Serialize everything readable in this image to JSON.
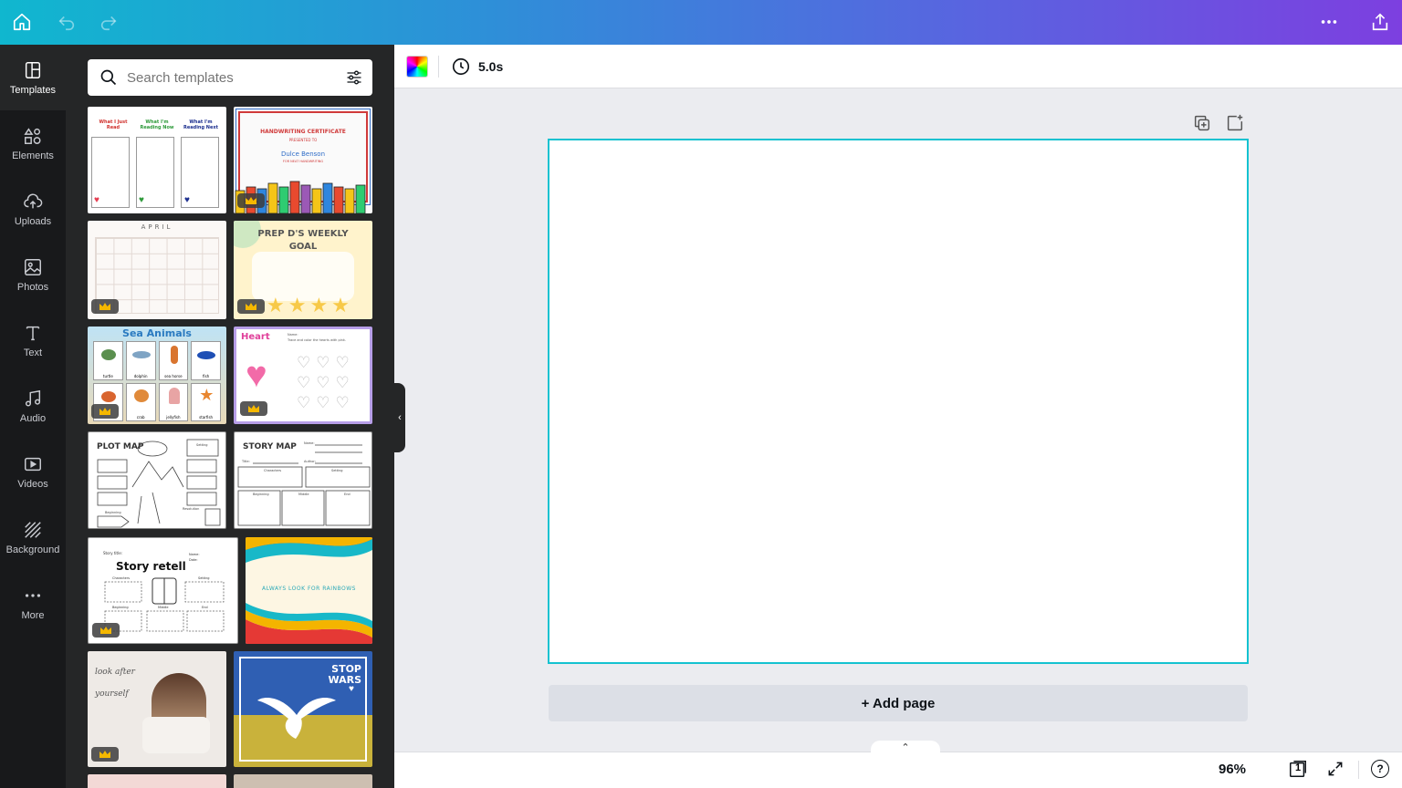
{
  "topbar": {
    "home": "home-icon",
    "undo": "undo-icon",
    "redo": "redo-icon",
    "more": "more-icon",
    "share": "share-icon"
  },
  "rail": {
    "items": [
      {
        "label": "Templates",
        "icon": "templates-icon"
      },
      {
        "label": "Elements",
        "icon": "elements-icon"
      },
      {
        "label": "Uploads",
        "icon": "uploads-icon"
      },
      {
        "label": "Photos",
        "icon": "photos-icon"
      },
      {
        "label": "Text",
        "icon": "text-icon"
      },
      {
        "label": "Audio",
        "icon": "audio-icon"
      },
      {
        "label": "Videos",
        "icon": "videos-icon"
      },
      {
        "label": "Background",
        "icon": "background-icon"
      },
      {
        "label": "More",
        "icon": "more-icon"
      }
    ]
  },
  "panel": {
    "search_placeholder": "Search templates"
  },
  "templates": {
    "t1": {
      "h1": "What I Just Read",
      "h2": "What I'm Reading Now",
      "h3": "What I'm Reading Next"
    },
    "t2": {
      "title": "HANDWRITING CERTIFICATE",
      "sub": "PRESENTED TO",
      "name": "Dulce Benson",
      "line": "FOR NEAT HANDWRITING"
    },
    "t3": {
      "title": "APRIL"
    },
    "t4": {
      "title": "PREP D'S WEEKLY GOAL"
    },
    "t5": {
      "title": "Sea Animals",
      "labels": [
        "turtle",
        "dolphin",
        "sea horse",
        "fish",
        "crab",
        "jellyfish",
        "starfish"
      ]
    },
    "t6": {
      "title": "Heart",
      "line1": "Name:",
      "line2": "Trace and color the hearts with pink."
    },
    "t7": {
      "title": "PLOT MAP",
      "l1": "Setting",
      "l2": "Beginning",
      "l3": "Resolution"
    },
    "t8": {
      "title": "STORY MAP",
      "l1": "Name:",
      "l2": "Title:",
      "l3": "Author:",
      "l4": "Characters",
      "l5": "Setting",
      "l6": "Beginning",
      "l7": "Middle",
      "l8": "End"
    },
    "t9": {
      "title": "Story retell",
      "l0": "Story title:",
      "l1": "Characters",
      "l2": "Setting",
      "l3": "Beginning",
      "l4": "Middle",
      "l5": "End",
      "n1": "Name:",
      "n2": "Date:"
    },
    "t10": {
      "title": "ALWAYS LOOK FOR RAINBOWS"
    },
    "t11": {
      "l1": "look after",
      "l2": "yourself"
    },
    "t12": {
      "title": "STOP WARS"
    }
  },
  "editor": {
    "duration": "5.0s",
    "add_page": "+ Add page",
    "zoom": "96%",
    "page_count": "1",
    "help": "?"
  },
  "colors": {
    "accent": "#14c2d0",
    "rail": "#18191b",
    "panel": "#252627"
  }
}
